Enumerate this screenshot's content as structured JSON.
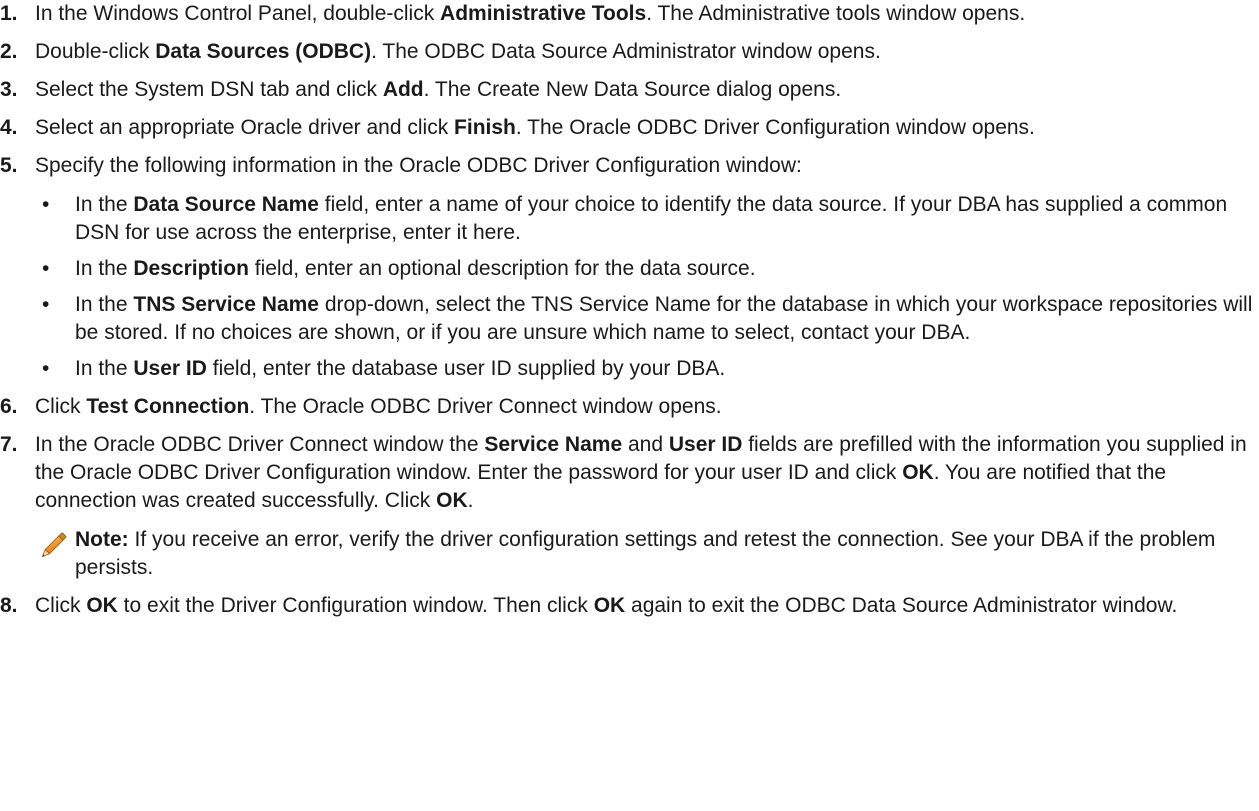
{
  "steps": [
    {
      "num": "1.",
      "t1": "In the Windows Control Panel, double-click ",
      "b1": "Administrative Tools",
      "t2": ". The Administrative tools window opens."
    },
    {
      "num": "2.",
      "t1": "Double-click ",
      "b1": "Data Sources (ODBC)",
      "t2": ". The ODBC Data Source Administrator window opens."
    },
    {
      "num": "3.",
      "t1": "Select the System DSN tab and click ",
      "b1": "Add",
      "t2": ". The Create New Data Source dialog opens."
    },
    {
      "num": "4.",
      "t1": "Select an appropriate Oracle driver and click ",
      "b1": "Finish",
      "t2": ". The Oracle ODBC Driver Configuration window opens."
    },
    {
      "num": "5.",
      "t1": "Specify the following information in the Oracle ODBC Driver Configuration window:",
      "bullets": [
        {
          "t1": "In the ",
          "b1": "Data Source Name",
          "t2": " field, enter a name of your choice to identify the data source. If your DBA has supplied a common DSN for use across the enterprise, enter it here."
        },
        {
          "t1": "In the ",
          "b1": "Description",
          "t2": " field, enter an optional description for the data source."
        },
        {
          "t1": "In the ",
          "b1": "TNS Service Name",
          "t2": " drop-down, select the TNS Service Name for the database in which your workspace repositories will be stored. If no choices are shown, or if you are unsure which name to select, contact your DBA."
        },
        {
          "t1": "In the ",
          "b1": "User ID",
          "t2": " field, enter the database user ID supplied by your DBA."
        }
      ]
    },
    {
      "num": "6.",
      "t1": "Click ",
      "b1": "Test Connection",
      "t2": ". The Oracle ODBC Driver Connect window opens."
    },
    {
      "num": "7.",
      "t1": "In the Oracle ODBC Driver Connect window the ",
      "b1": "Service Name",
      "t2": " and ",
      "b2": "User ID",
      "t3": " fields are prefilled with the information you supplied in the Oracle ODBC Driver Configuration window. Enter the password for your user ID and click ",
      "b3": "OK",
      "t4": ". You are notified that the connection was created successfully. Click ",
      "b4": "OK",
      "t5": ".",
      "note": {
        "label": "Note:",
        "text": " If you receive an error, verify the driver configuration settings and retest the connection. See your DBA if the problem persists.",
        "icon": "pencil-icon"
      }
    },
    {
      "num": "8.",
      "t1": "Click ",
      "b1": "OK",
      "t2": " to exit the Driver Configuration window. Then click ",
      "b2": "OK",
      "t3": " again to exit the ODBC Data Source Administrator window."
    }
  ],
  "bullet_glyph": "•"
}
